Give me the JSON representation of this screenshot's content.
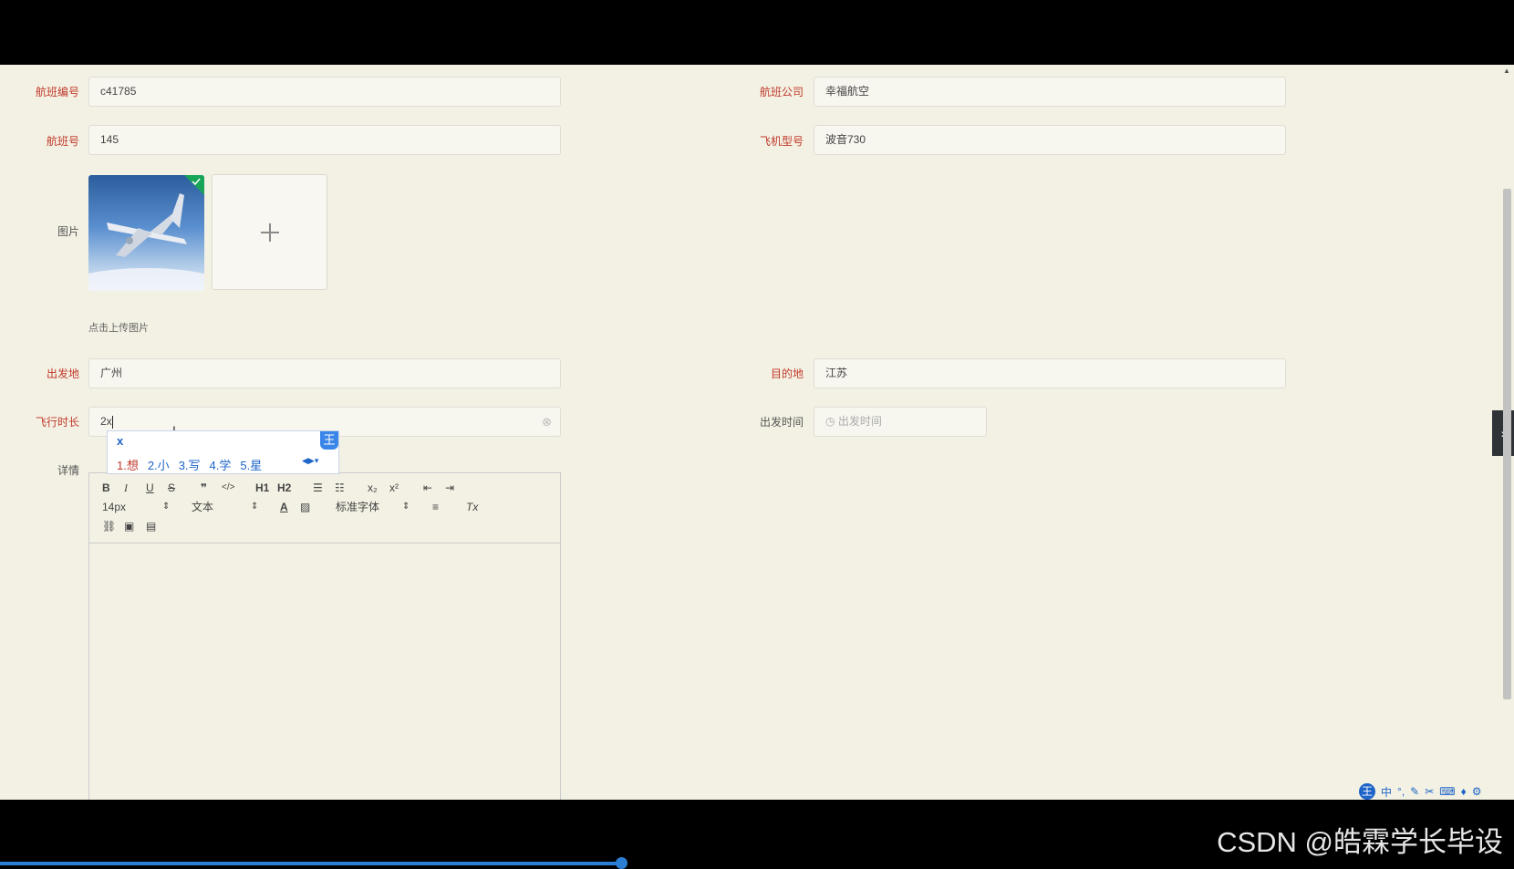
{
  "form": {
    "flight_code_label": "航班编号",
    "flight_code_value": "c41785",
    "airline_label": "航班公司",
    "airline_value": "幸福航空",
    "flight_no_label": "航班号",
    "flight_no_value": "145",
    "plane_model_label": "飞机型号",
    "plane_model_value": "波音730",
    "image_label": "图片",
    "upload_hint": "点击上传图片",
    "origin_label": "出发地",
    "origin_value": "广州",
    "destination_label": "目的地",
    "destination_value": "江苏",
    "duration_label": "飞行时长",
    "duration_value": "2x",
    "depart_time_label": "出发时间",
    "depart_time_placeholder": "出发时间",
    "detail_label": "详情"
  },
  "editor": {
    "bold": "B",
    "italic": "I",
    "underline": "U",
    "strike": "S",
    "quote": "❞",
    "code": "</>",
    "h1": "H1",
    "h2": "H2",
    "sub": "x₂",
    "sup": "x²",
    "font_size": "14px",
    "text_type": "文本",
    "font_family": "标准字体",
    "clear": "Tx"
  },
  "ime": {
    "input": "x",
    "badge": "王",
    "candidates": [
      "1.想",
      "2.小",
      "3.写",
      "4.学",
      "5.星"
    ]
  },
  "tray": {
    "badge": "王",
    "mode": "中"
  },
  "watermark": "CSDN @皓霖学长毕设",
  "colors": {
    "required_label": "#c0392b",
    "accent": "#1e64c8",
    "page_bg": "#f3f1e3"
  }
}
